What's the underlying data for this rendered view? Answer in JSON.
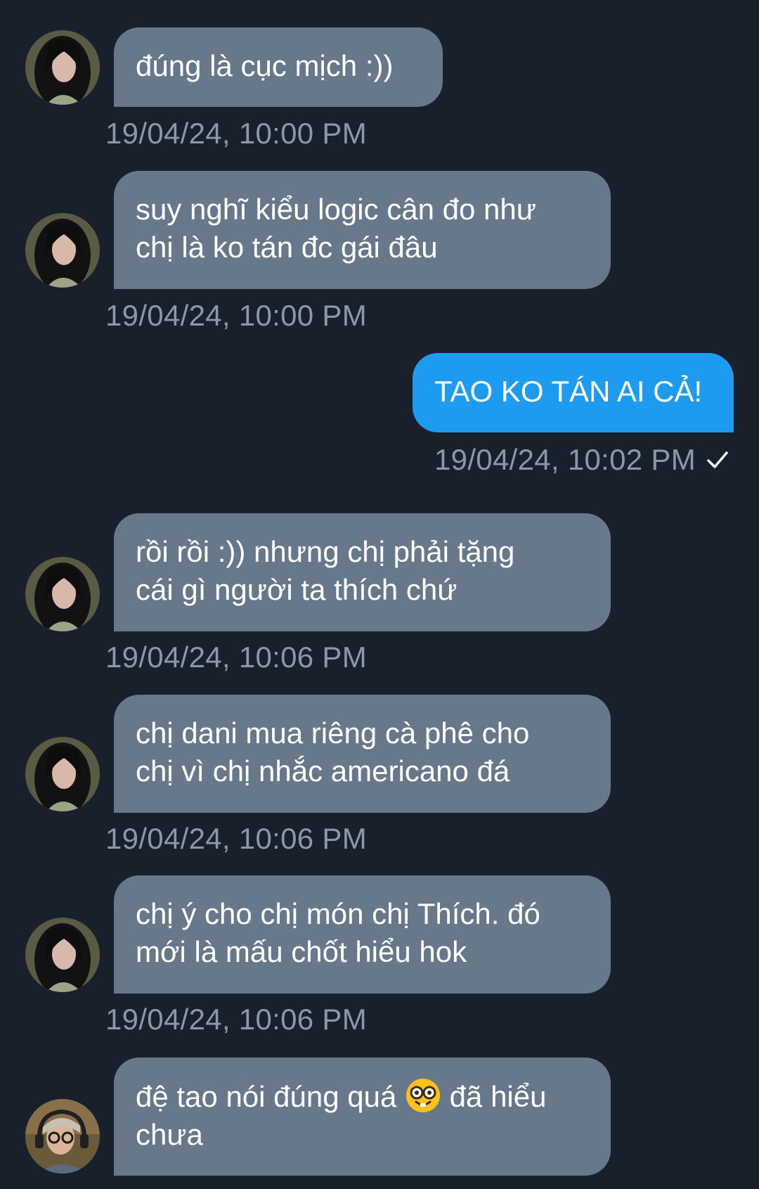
{
  "colors": {
    "background": "#17202b",
    "incoming_bubble": "#66788a",
    "outgoing_bubble": "#1d9bf0",
    "timestamp": "#8b98a5"
  },
  "messages": [
    {
      "direction": "incoming",
      "text": "đúng là cục mịch :))",
      "time": "19/04/24, 10:00 PM",
      "avatar": "girl-avatar"
    },
    {
      "direction": "incoming",
      "text": "suy nghĩ kiểu logic cân đo như\nchị là ko tán đc gái đâu",
      "time": "19/04/24, 10:00 PM",
      "avatar": "girl-avatar"
    },
    {
      "direction": "outgoing",
      "text": "TAO KO TÁN AI CẢ!",
      "time": "19/04/24, 10:02 PM",
      "status_icon": "check-icon"
    },
    {
      "direction": "incoming",
      "text": "rồi rồi :)) nhưng chị phải tặng\ncái gì người ta thích chứ",
      "time": "19/04/24, 10:06 PM",
      "avatar": "girl-avatar"
    },
    {
      "direction": "incoming",
      "text": "chị dani mua riêng cà phê cho\nchị vì chị nhắc americano đá",
      "time": "19/04/24, 10:06 PM",
      "avatar": "girl-avatar"
    },
    {
      "direction": "incoming",
      "text": "chị ý cho chị món chị Thích. đó\nmới là mấu chốt hiểu hok",
      "time": "19/04/24, 10:06 PM",
      "avatar": "girl-avatar"
    },
    {
      "direction": "incoming",
      "text_before_emoji": "đệ tao nói đúng quá ",
      "emoji": "nerd-face-emoji",
      "text_after_emoji": " đã hiểu\nchưa",
      "avatar": "headphones-avatar"
    }
  ]
}
